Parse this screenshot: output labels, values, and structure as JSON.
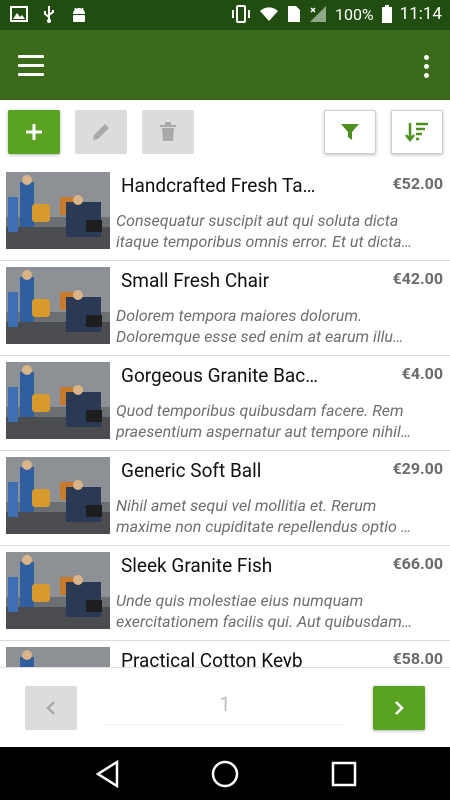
{
  "status_bar": {
    "battery_percent": "100%",
    "time": "11:14"
  },
  "products": [
    {
      "title": "Handcrafted Fresh Ta…",
      "price": "€52.00",
      "desc_line1": "Consequatur suscipit aut qui soluta dicta",
      "desc_line2": "itaque temporibus omnis error. Et ut dicta…"
    },
    {
      "title": "Small Fresh Chair",
      "price": "€42.00",
      "desc_line1": "Dolorem tempora maiores dolorum.",
      "desc_line2": "Doloremque esse sed enim at earum illu…"
    },
    {
      "title": "Gorgeous Granite Bac…",
      "price": "€4.00",
      "desc_line1": "Quod temporibus quibusdam facere. Rem",
      "desc_line2": "praesentium aspernatur aut tempore nihil…"
    },
    {
      "title": "Generic Soft Ball",
      "price": "€29.00",
      "desc_line1": "Nihil amet sequi vel mollitia et. Rerum",
      "desc_line2": "maxime non cupiditate repellendus optio …"
    },
    {
      "title": "Sleek Granite Fish",
      "price": "€66.00",
      "desc_line1": "Unde quis molestiae eius numquam",
      "desc_line2": "exercitationem facilis qui. Aut quibusdam…"
    },
    {
      "title": "Practical Cotton Keyb",
      "price": "€58.00",
      "desc_line1": "",
      "desc_line2": ""
    }
  ],
  "pagination": {
    "current_page": "1"
  },
  "colors": {
    "status_bar": "#224d10",
    "app_bar": "#3a6a1a",
    "accent_green": "#5aa322"
  }
}
